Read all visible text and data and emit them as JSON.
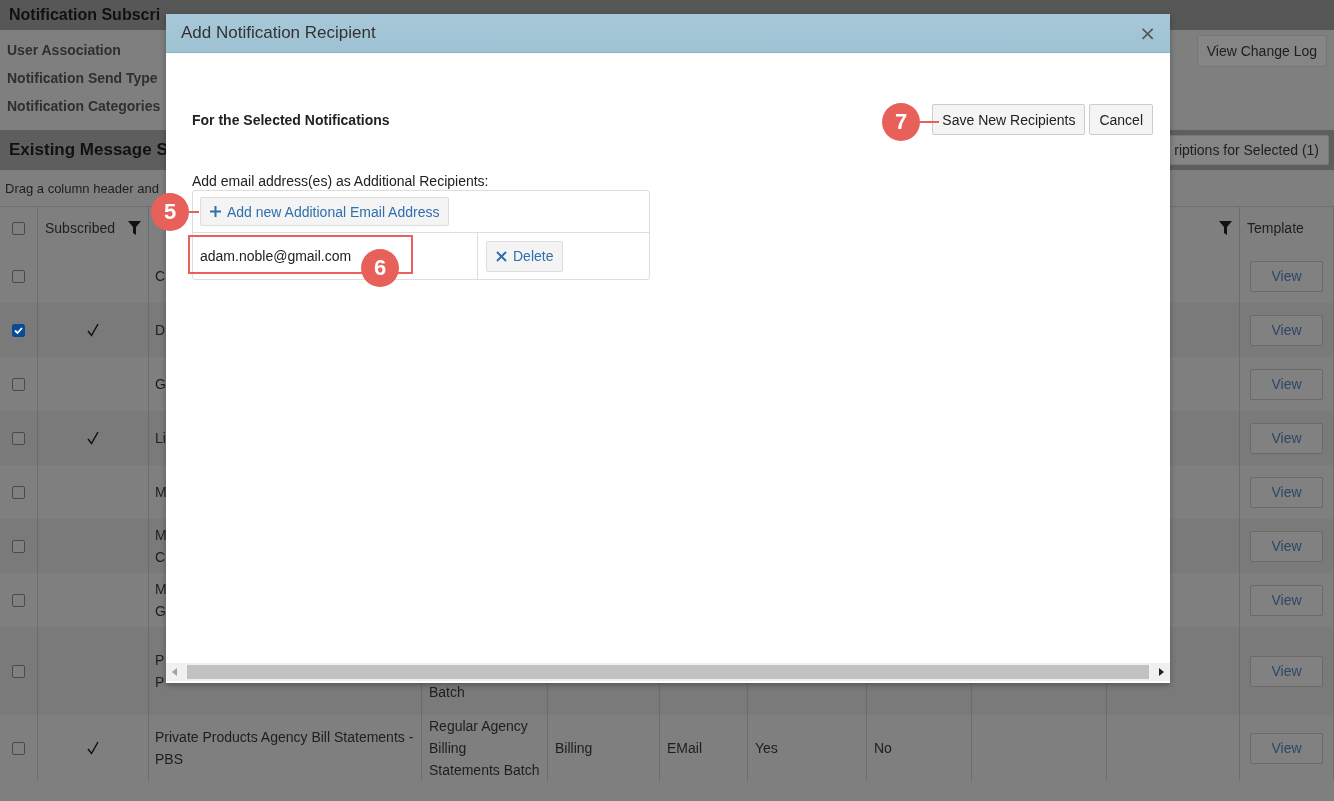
{
  "page": {
    "title": "Notification Subscri",
    "filters": [
      "User Association",
      "Notification Send Type",
      "Notification Categories"
    ],
    "change_log_button": "View Change Log",
    "section_title": "Existing Message S",
    "section_button": "riptions for Selected (1)",
    "group_hint": "Drag a column header and",
    "table": {
      "select_all_checked": false,
      "columns": [
        {
          "label": "Subscribed",
          "filter": true
        },
        {
          "filter": true
        },
        {
          "label": "Template",
          "filter": false
        }
      ],
      "rows": [
        {
          "checked": false,
          "subscribed": false,
          "name": "C",
          "cells": [],
          "view": "View"
        },
        {
          "checked": true,
          "subscribed": true,
          "name": "D",
          "cells": [],
          "view": "View"
        },
        {
          "checked": false,
          "subscribed": false,
          "name": "G",
          "cells": [],
          "view": "View"
        },
        {
          "checked": false,
          "subscribed": true,
          "name": "Li",
          "cells": [],
          "view": "View"
        },
        {
          "checked": false,
          "subscribed": false,
          "name": "M",
          "cells": [],
          "view": "View"
        },
        {
          "checked": false,
          "subscribed": false,
          "name": "M\nC",
          "cells": [],
          "view": "View"
        },
        {
          "checked": false,
          "subscribed": false,
          "name": "M\nG",
          "cells": [],
          "view": "View"
        },
        {
          "checked": false,
          "subscribed": false,
          "name": "P\nP",
          "cells": [
            "Batch"
          ],
          "view": "View"
        },
        {
          "checked": false,
          "subscribed": true,
          "name": "Private Products Agency Bill Statements - PBS",
          "cells": [
            "Regular Agency Billing Statements Batch",
            "Billing",
            "EMail",
            "Yes",
            "No"
          ],
          "view": "View"
        }
      ]
    }
  },
  "dialog": {
    "title": "Add Notification Recipient",
    "close": "×",
    "heading": "For the Selected Notifications",
    "buttons": [
      "Save New Recipients",
      "Cancel"
    ],
    "recipients_label": "Add email address(es) as Additional Recipients:",
    "add_button": "Add new Additional Email Address",
    "recipients": [
      {
        "email": "adam.noble@gmail.com",
        "delete": "Delete"
      }
    ]
  },
  "annotations": [
    {
      "label": "5"
    },
    {
      "label": "6"
    },
    {
      "label": "7"
    }
  ]
}
